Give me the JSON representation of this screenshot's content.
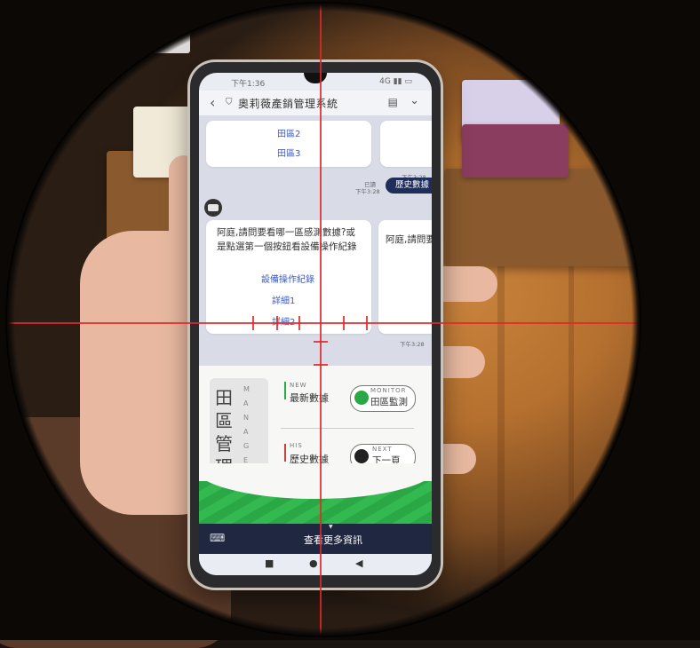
{
  "status_bar": {
    "time": "下午1:36",
    "signal": "4G ▮▮ ▭"
  },
  "app_header": {
    "title": "奧莉薇產銷管理系統"
  },
  "chat": {
    "field_items": [
      "田區2",
      "田區3"
    ],
    "timestamp_1": "下午3:28",
    "read_label": "已讀",
    "read_time": "下午3:28",
    "user_bubble": "歷史數據",
    "bot_message_line1": "阿庭,請問要看哪一區感測數據?或",
    "bot_message_line2": "是點選第一個按鈕看設備操作紀錄",
    "bot_options": [
      "設備操作紀錄",
      "詳細1",
      "詳細2"
    ],
    "second_card_text": "阿庭,請問要看",
    "timestamp_2": "下午3:28"
  },
  "rich_menu": {
    "manage_chars": [
      "田",
      "區",
      "管",
      "理"
    ],
    "manage_letters": [
      "M",
      "A",
      "N",
      "A",
      "G",
      "E"
    ],
    "new_small": "NEW",
    "new_label": "最新數據",
    "monitor_small": "MONITOR",
    "monitor_label": "田區監測",
    "his_small": "HIS",
    "his_label": "歷史數據",
    "next_small": "NEXT",
    "next_label": "下一頁"
  },
  "footer": {
    "label": "查看更多資訊"
  },
  "colors": {
    "navy": "#1f2741",
    "green": "#2aa845",
    "crosshair": "#e12828"
  }
}
